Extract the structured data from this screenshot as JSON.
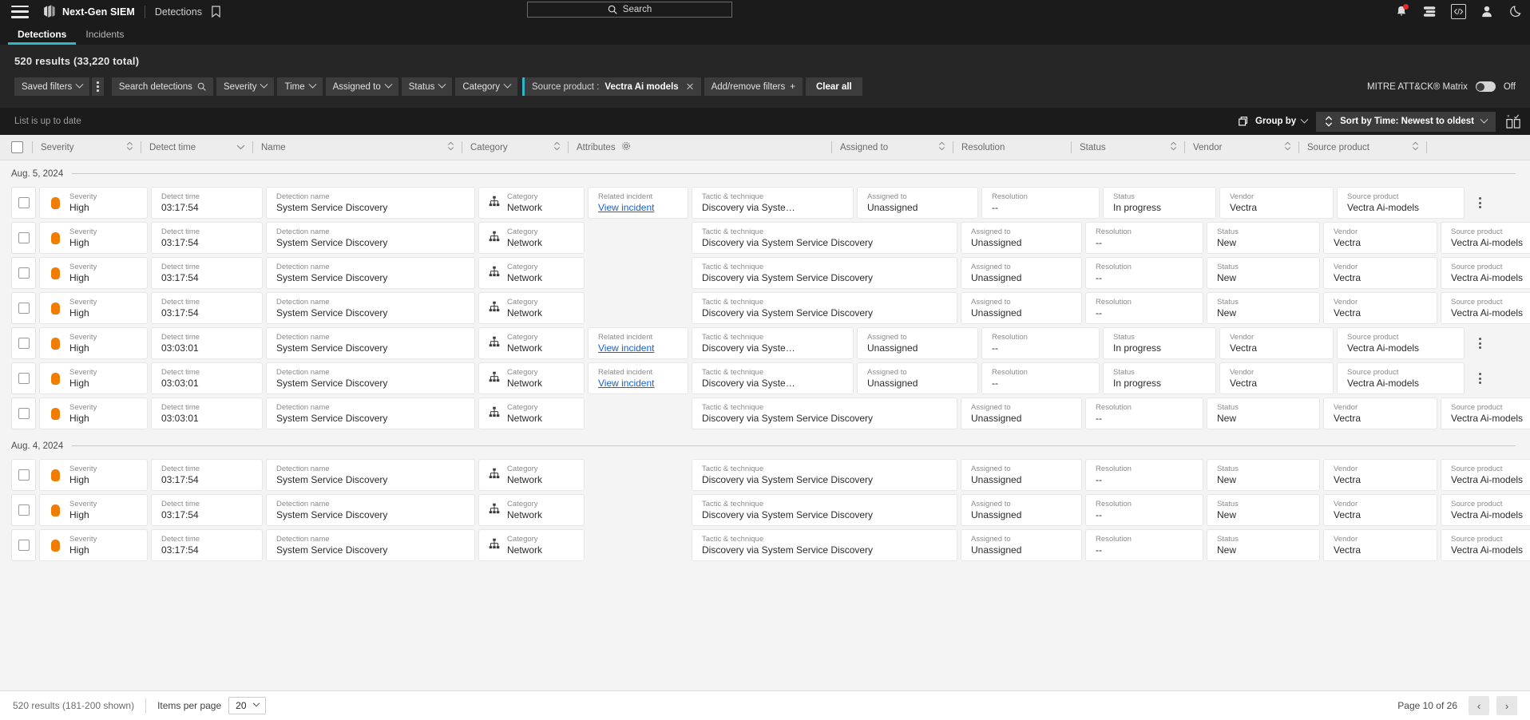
{
  "topbar": {
    "menu_icon": "hamburger-icon",
    "brand": "Next-Gen SIEM",
    "breadcrumb": "Detections",
    "bookmark_icon": "bookmark-icon",
    "search_placeholder": "Search",
    "search_value": "",
    "icons": [
      "notifications-bell-icon",
      "feed-icon",
      "code-icon",
      "user-account-icon",
      "dark-mode-moon-icon"
    ]
  },
  "tabs": [
    {
      "label": "Detections",
      "active": true
    },
    {
      "label": "Incidents",
      "active": false
    }
  ],
  "results": {
    "summary": "520 results (33,220 total)"
  },
  "filters": {
    "saved_filters": "Saved filters",
    "kebab": "more-options-icon",
    "search_detections": "Search detections",
    "severity": "Severity",
    "time": "Time",
    "assigned_to": "Assigned to",
    "status": "Status",
    "category": "Category",
    "chip_label": "Source product :",
    "chip_value": "Vectra Ai models",
    "chip_remove": "✕",
    "add_remove": "Add/remove filters",
    "add_remove_plus": "+",
    "clear_all": "Clear all",
    "mitre_label": "MITRE ATT&CK® Matrix",
    "mitre_state": "Off"
  },
  "subtoolbar": {
    "status_text": "List is up to date",
    "group_by": "Group by",
    "sort_by": "Sort by Time: Newest to oldest",
    "columns_icon": "choose-columns-icon"
  },
  "table": {
    "columns": [
      {
        "key": "severity",
        "label": "Severity",
        "sortable": true
      },
      {
        "key": "detect_time",
        "label": "Detect time",
        "sortable": true
      },
      {
        "key": "name",
        "label": "Name",
        "sortable": true
      },
      {
        "key": "category",
        "label": "Category",
        "sortable": true
      },
      {
        "key": "attributes",
        "label": "Attributes",
        "sortable": false
      },
      {
        "key": "assigned_to",
        "label": "Assigned to",
        "sortable": true
      },
      {
        "key": "resolution",
        "label": "Resolution",
        "sortable": false
      },
      {
        "key": "status",
        "label": "Status",
        "sortable": true
      },
      {
        "key": "vendor",
        "label": "Vendor",
        "sortable": true
      },
      {
        "key": "source_product",
        "label": "Source product",
        "sortable": true
      }
    ],
    "cell_labels": {
      "severity": "Severity",
      "detect_time": "Detect time",
      "name": "Detection name",
      "category": "Category",
      "related_incident": "Related incident",
      "tactic": "Tactic & technique",
      "assigned_to": "Assigned to",
      "resolution": "Resolution",
      "status": "Status",
      "vendor": "Vendor",
      "source_product": "Source product"
    },
    "groups": [
      {
        "date": "Aug. 5, 2024",
        "rows": [
          {
            "severity": "High",
            "detect_time": "03:17:54",
            "name": "System Service Discovery",
            "category": "Network",
            "related_incident": "View incident",
            "tactic": "Discovery via Syste…",
            "assigned_to": "Unassigned",
            "resolution": "--",
            "status": "In progress",
            "vendor": "Vectra",
            "source_product": "Vectra Ai-models"
          },
          {
            "severity": "High",
            "detect_time": "03:17:54",
            "name": "System Service Discovery",
            "category": "Network",
            "related_incident": "",
            "tactic": "Discovery via System Service Discovery",
            "assigned_to": "Unassigned",
            "resolution": "--",
            "status": "New",
            "vendor": "Vectra",
            "source_product": "Vectra Ai-models"
          },
          {
            "severity": "High",
            "detect_time": "03:17:54",
            "name": "System Service Discovery",
            "category": "Network",
            "related_incident": "",
            "tactic": "Discovery via System Service Discovery",
            "assigned_to": "Unassigned",
            "resolution": "--",
            "status": "New",
            "vendor": "Vectra",
            "source_product": "Vectra Ai-models"
          },
          {
            "severity": "High",
            "detect_time": "03:17:54",
            "name": "System Service Discovery",
            "category": "Network",
            "related_incident": "",
            "tactic": "Discovery via System Service Discovery",
            "assigned_to": "Unassigned",
            "resolution": "--",
            "status": "New",
            "vendor": "Vectra",
            "source_product": "Vectra Ai-models"
          },
          {
            "severity": "High",
            "detect_time": "03:03:01",
            "name": "System Service Discovery",
            "category": "Network",
            "related_incident": "View incident",
            "tactic": "Discovery via Syste…",
            "assigned_to": "Unassigned",
            "resolution": "--",
            "status": "In progress",
            "vendor": "Vectra",
            "source_product": "Vectra Ai-models"
          },
          {
            "severity": "High",
            "detect_time": "03:03:01",
            "name": "System Service Discovery",
            "category": "Network",
            "related_incident": "View incident",
            "tactic": "Discovery via Syste…",
            "assigned_to": "Unassigned",
            "resolution": "--",
            "status": "In progress",
            "vendor": "Vectra",
            "source_product": "Vectra Ai-models"
          },
          {
            "severity": "High",
            "detect_time": "03:03:01",
            "name": "System Service Discovery",
            "category": "Network",
            "related_incident": "",
            "tactic": "Discovery via System Service Discovery",
            "assigned_to": "Unassigned",
            "resolution": "--",
            "status": "New",
            "vendor": "Vectra",
            "source_product": "Vectra Ai-models"
          }
        ]
      },
      {
        "date": "Aug. 4, 2024",
        "rows": [
          {
            "severity": "High",
            "detect_time": "03:17:54",
            "name": "System Service Discovery",
            "category": "Network",
            "related_incident": "",
            "tactic": "Discovery via System Service Discovery",
            "assigned_to": "Unassigned",
            "resolution": "--",
            "status": "New",
            "vendor": "Vectra",
            "source_product": "Vectra Ai-models"
          },
          {
            "severity": "High",
            "detect_time": "03:17:54",
            "name": "System Service Discovery",
            "category": "Network",
            "related_incident": "",
            "tactic": "Discovery via System Service Discovery",
            "assigned_to": "Unassigned",
            "resolution": "--",
            "status": "New",
            "vendor": "Vectra",
            "source_product": "Vectra Ai-models"
          },
          {
            "severity": "High",
            "detect_time": "03:17:54",
            "name": "System Service Discovery",
            "category": "Network",
            "related_incident": "",
            "tactic": "Discovery via System Service Discovery",
            "assigned_to": "Unassigned",
            "resolution": "--",
            "status": "New",
            "vendor": "Vectra",
            "source_product": "Vectra Ai-models"
          }
        ]
      }
    ]
  },
  "footer": {
    "results_text": "520 results (181-200 shown)",
    "items_per_page_label": "Items per page",
    "items_per_page_value": "20",
    "page_text": "Page 10 of 26",
    "prev": "‹",
    "next": "›"
  },
  "colors": {
    "accent": "#2fb6c9",
    "severity_high": "#f07d00",
    "link": "#1a62c4",
    "badge": "#e8262b",
    "topbar_bg": "#1b1b1b",
    "filter_bg": "#262626"
  }
}
